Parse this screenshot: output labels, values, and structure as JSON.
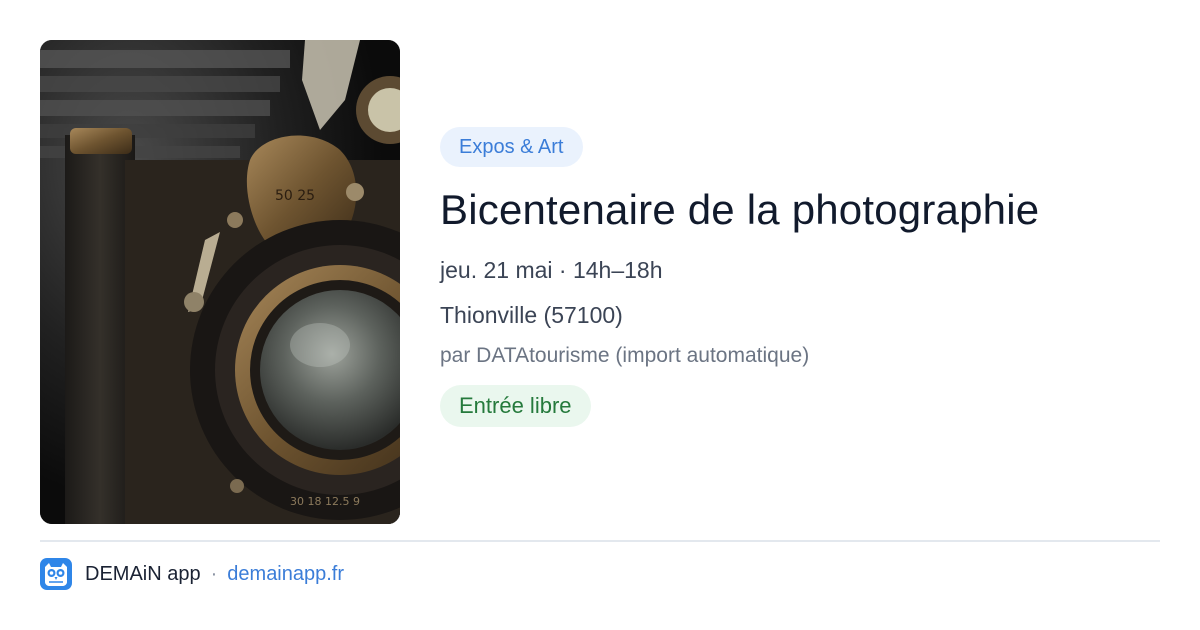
{
  "event": {
    "image_alt": "Appareil photo ancien",
    "category": "Expos & Art",
    "title": "Bicentenaire de la photographie",
    "date_time": "jeu. 21 mai · 14h–18h",
    "location": "Thionville (57100)",
    "source": "par DATAtourisme (import automatique)",
    "price": "Entrée libre"
  },
  "footer": {
    "app_name": "DEMAiN app",
    "separator": "·",
    "site": "demainapp.fr",
    "logo_icon": "owl-logo-icon"
  },
  "colors": {
    "category_bg": "#eaf2fd",
    "category_text": "#3b7dd8",
    "price_bg": "#eaf7ee",
    "price_text": "#257a3c",
    "link": "#3b7dd8",
    "title_text": "#111a2c"
  }
}
